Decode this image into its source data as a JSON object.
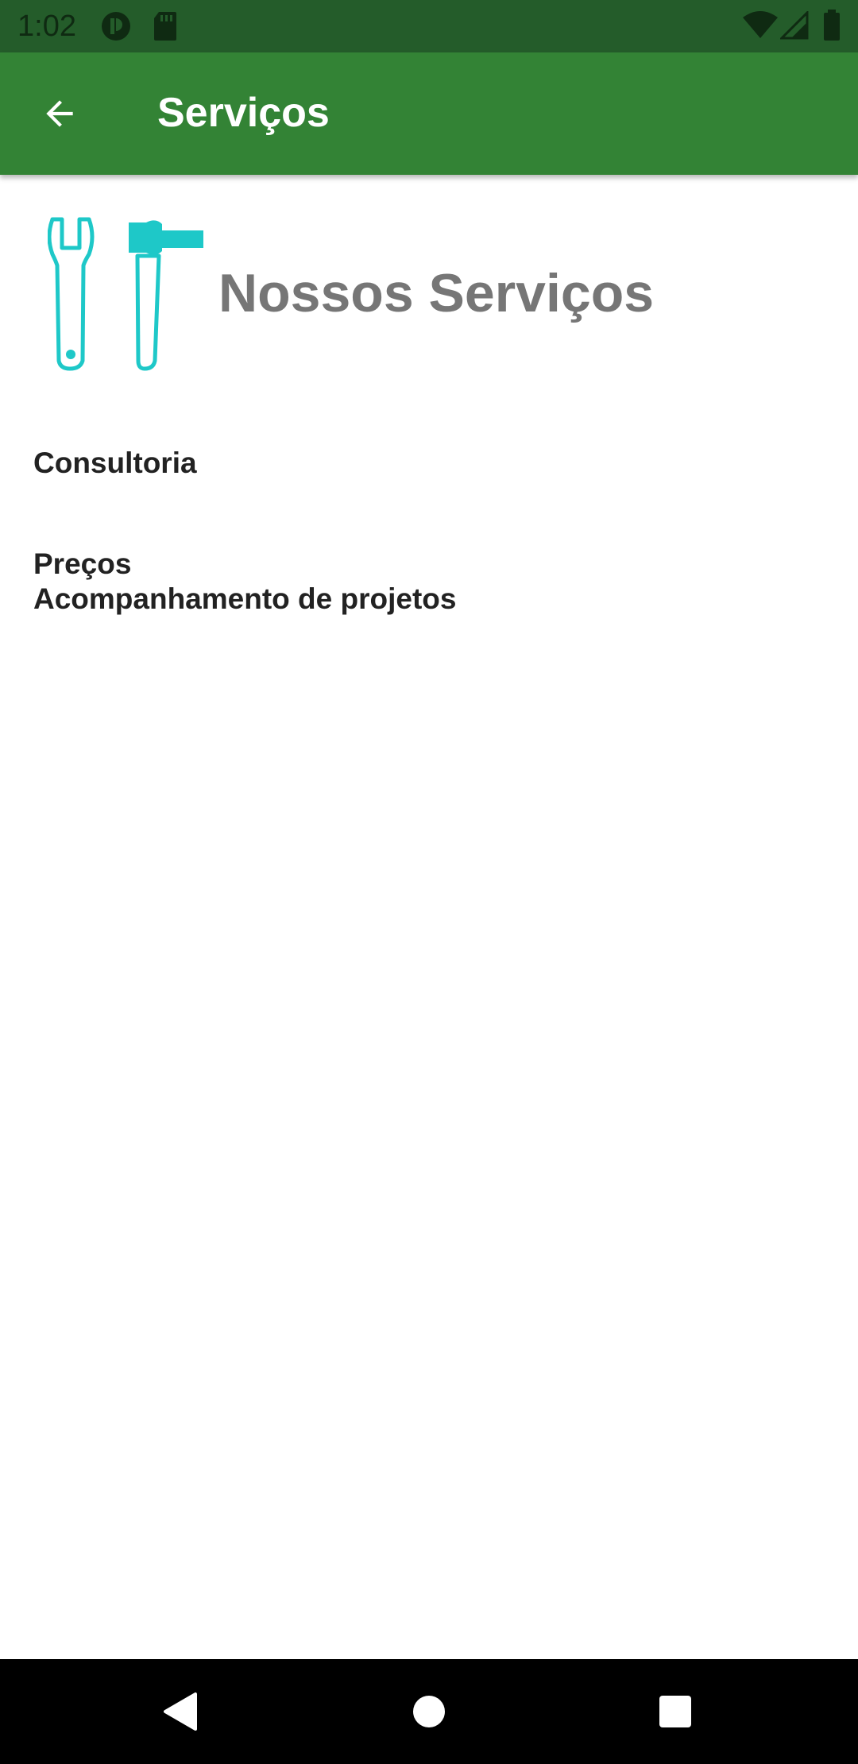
{
  "status_bar": {
    "time": "1:02",
    "icons": [
      "app-notification-icon",
      "sd-card-icon",
      "wifi-icon",
      "cell-signal-icon",
      "battery-icon"
    ]
  },
  "app_bar": {
    "title": "Serviços",
    "back_icon": "arrow-back-icon",
    "color": "#338335"
  },
  "main": {
    "heading": "Nossos Serviços",
    "header_icon": "tools-icon",
    "icon_color": "#1ec8c8",
    "items": [
      {
        "label": "Consultoria"
      },
      {
        "label": "Preços"
      },
      {
        "label": "Acompanhamento de projetos"
      }
    ]
  },
  "nav_bar": {
    "buttons": [
      "back-triangle-icon",
      "home-circle-icon",
      "recents-square-icon"
    ]
  }
}
